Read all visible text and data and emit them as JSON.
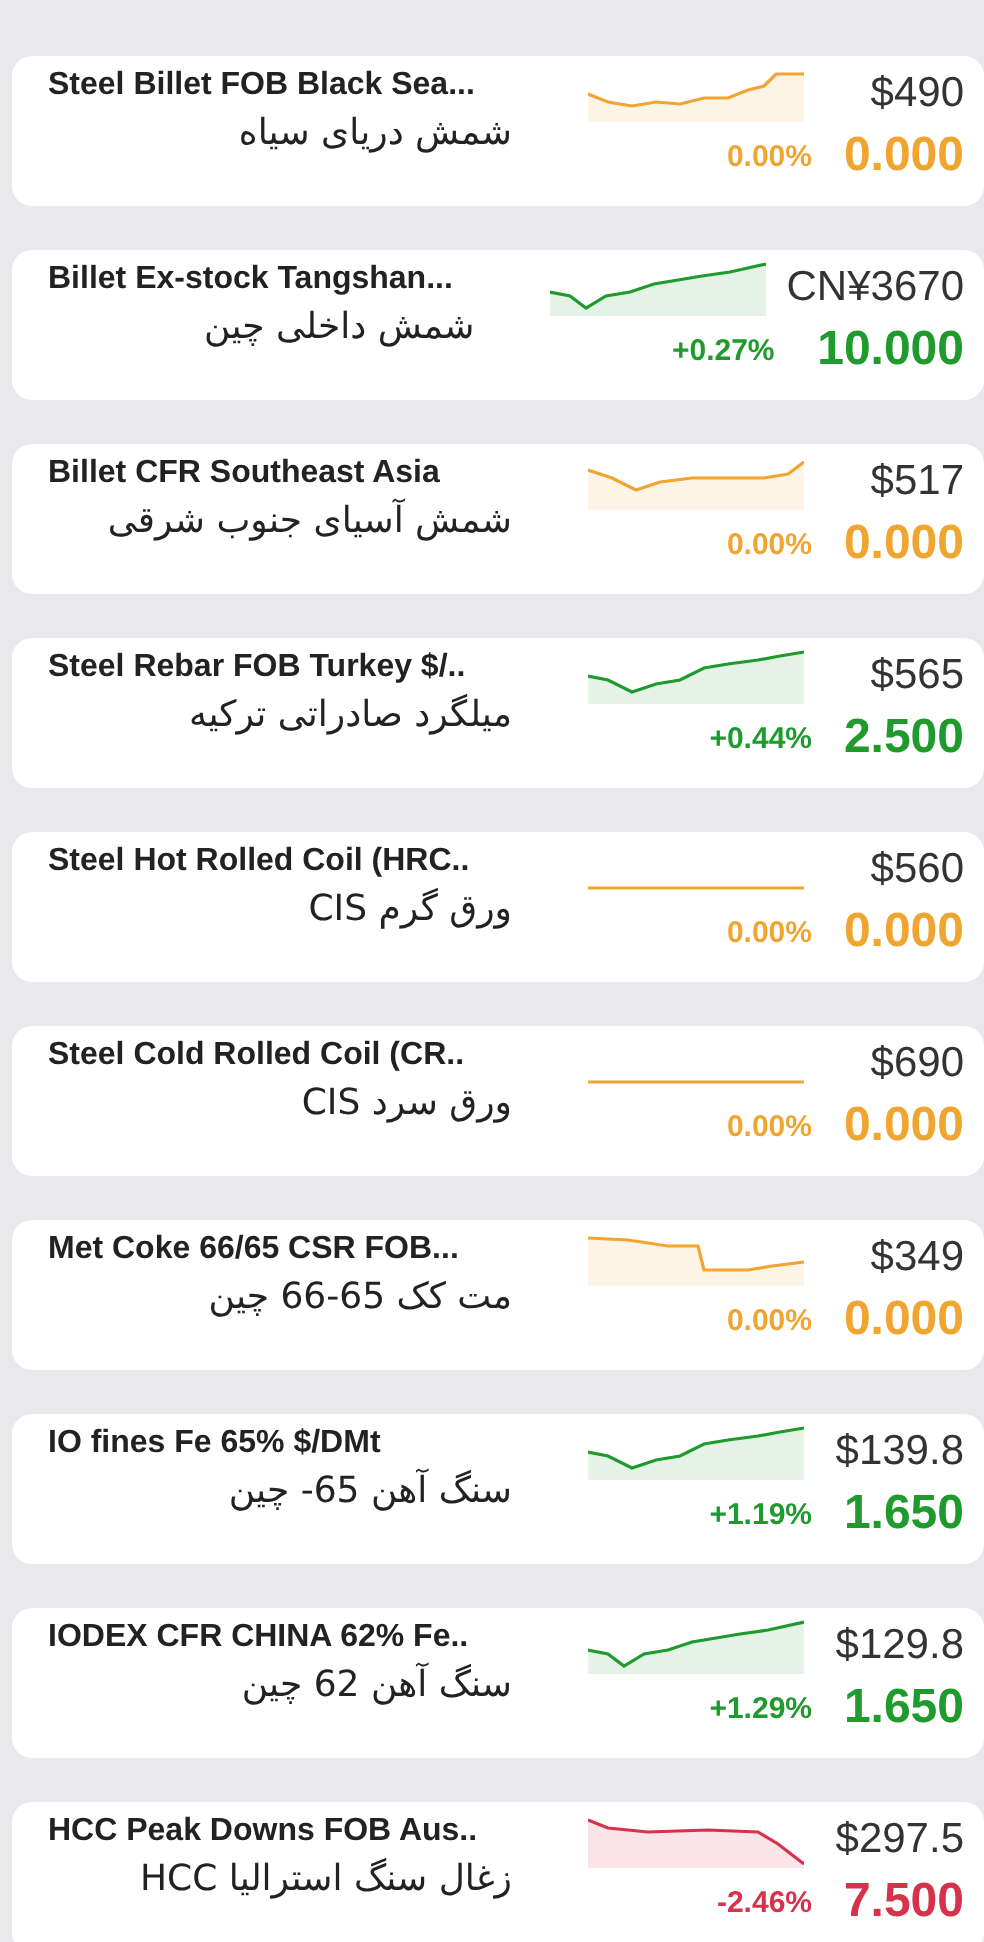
{
  "rows": [
    {
      "title": "Steel Billet FOB Black Sea...",
      "subtitle": "شمش دریای سیاه",
      "price": "$490",
      "change_percent": "0.00%",
      "change": "0.000",
      "color": "#f0a531"
    },
    {
      "title": "Billet Ex-stock Tangshan...",
      "subtitle": "شمش داخلی چین",
      "price": "CN¥3670",
      "change_percent": "+0.27%",
      "change": "10.000",
      "color": "#1f9a2c"
    },
    {
      "title": "Billet CFR Southeast Asia",
      "subtitle": "شمش آسیای جنوب شرقی",
      "price": "$517",
      "change_percent": "0.00%",
      "change": "0.000",
      "color": "#f0a531"
    },
    {
      "title": "Steel Rebar FOB Turkey $/..",
      "subtitle": "میلگرد صادراتی ترکیه",
      "price": "$565",
      "change_percent": "+0.44%",
      "change": "2.500",
      "color": "#1f9a2c"
    },
    {
      "title": "Steel Hot Rolled Coil (HRC..",
      "subtitle": "ورق گرم CIS",
      "price": "$560",
      "change_percent": "0.00%",
      "change": "0.000",
      "color": "#f0a531"
    },
    {
      "title": "Steel Cold Rolled Coil (CR..",
      "subtitle": "ورق سرد CIS",
      "price": "$690",
      "change_percent": "0.00%",
      "change": "0.000",
      "color": "#f0a531"
    },
    {
      "title": "Met Coke 66/65 CSR FOB...",
      "subtitle": "مت کک 65-66 چین",
      "price": "$349",
      "change_percent": "0.00%",
      "change": "0.000",
      "color": "#f0a531"
    },
    {
      "title": "IO fines Fe 65% $/DMt",
      "subtitle": "سنگ آهن 65- چین",
      "price": "$139.8",
      "change_percent": "+1.19%",
      "change": "1.650",
      "color": "#1f9a2c"
    },
    {
      "title": "IODEX CFR CHINA 62% Fe..",
      "subtitle": "سنگ آهن 62 چین",
      "price": "$129.8",
      "change_percent": "+1.29%",
      "change": "1.650",
      "color": "#1f9a2c"
    },
    {
      "title": "HCC Peak Downs FOB Aus..",
      "subtitle": "زغال سنگ استرالیا HCC",
      "price": "$297.5",
      "change_percent": "-2.46%",
      "change": "7.500",
      "color": "#d7324c"
    }
  ]
}
